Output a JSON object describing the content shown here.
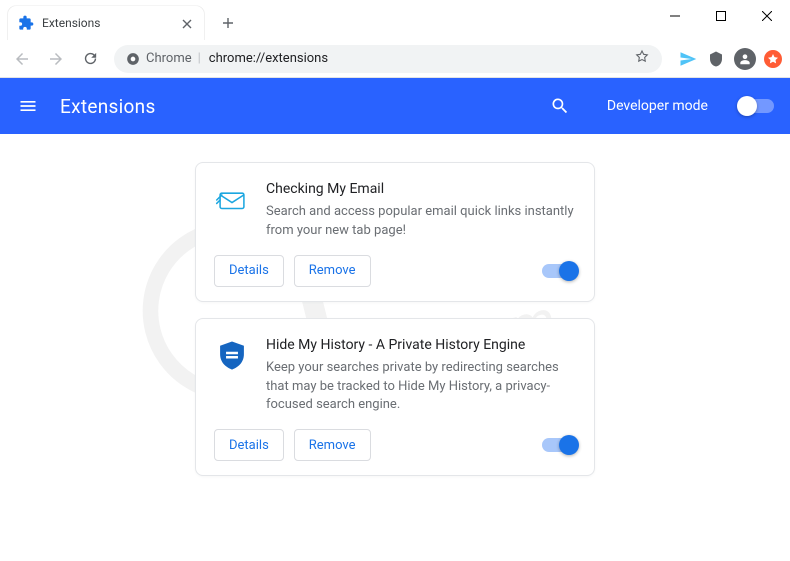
{
  "window": {
    "tab_label": "Extensions"
  },
  "nav": {
    "chip_label": "Chrome",
    "url": "chrome://extensions"
  },
  "appbar": {
    "title": "Extensions",
    "dev_mode_label": "Developer mode"
  },
  "cards": [
    {
      "name": "Checking My Email",
      "desc": "Search and access popular email quick links instantly from your new tab page!",
      "details": "Details",
      "remove": "Remove"
    },
    {
      "name": "Hide My History - A Private History Engine",
      "desc": "Keep your searches private by redirecting searches that may be tracked to Hide My History, a privacy-focused search engine.",
      "details": "Details",
      "remove": "Remove"
    }
  ]
}
